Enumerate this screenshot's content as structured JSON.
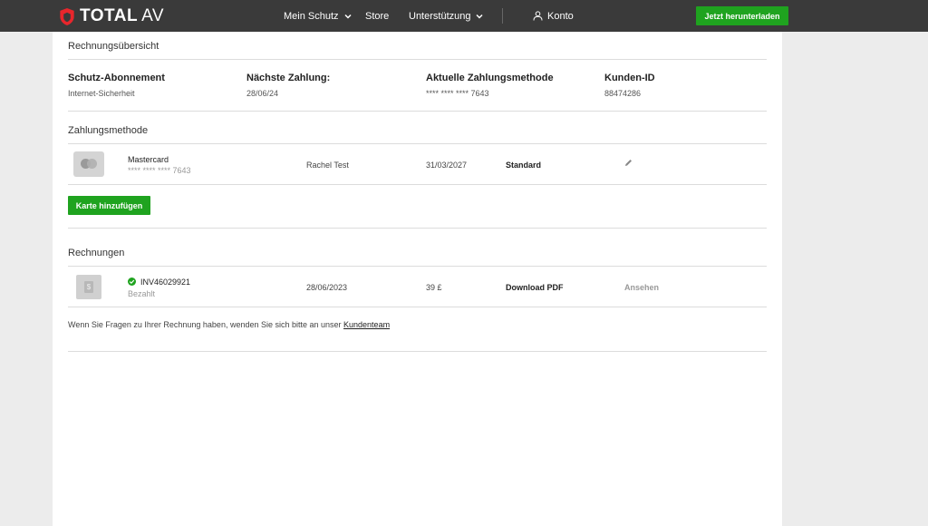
{
  "header": {
    "logo_total": "TOTAL",
    "logo_av": "AV",
    "nav": {
      "mein_schutz": "Mein Schutz",
      "store": "Store",
      "support": "Unterstützung",
      "account": "Konto"
    },
    "download_button": "Jetzt herunterladen"
  },
  "billing_overview": {
    "title": "Rechnungsübersicht",
    "subscription_label": "Schutz-Abonnement",
    "subscription_value": "Internet-Sicherheit",
    "next_payment_label": "Nächste Zahlung:",
    "next_payment_value": "28/06/24",
    "payment_method_label": "Aktuelle Zahlungsmethode",
    "payment_method_value": "**** **** **** 7643",
    "customer_id_label": "Kunden-ID",
    "customer_id_value": "88474286"
  },
  "payment_methods": {
    "title": "Zahlungsmethode",
    "card": {
      "brand": "Mastercard",
      "number": "**** **** **** 7643",
      "holder": "Rachel Test",
      "expiry": "31/03/2027",
      "badge": "Standard"
    },
    "add_card_button": "Karte hinzufügen"
  },
  "invoices": {
    "title": "Rechnungen",
    "items": [
      {
        "id": "INV46029921",
        "status": "Bezahlt",
        "date": "28/06/2023",
        "amount": "39 £",
        "download": "Download PDF",
        "view": "Ansehen"
      }
    ],
    "note_text": "Wenn Sie Fragen zu Ihrer Rechnung haben, wenden Sie sich bitte an unser ",
    "note_link": "Kundenteam"
  },
  "colors": {
    "accent": "#1fa31f",
    "brand_red": "#e8262c",
    "header_bg": "#3a3a3a"
  },
  "icons": [
    "shield-logo-icon",
    "chevron-down-icon",
    "user-icon",
    "mastercard-icon",
    "pencil-icon",
    "check-circle-icon",
    "invoice-document-icon"
  ]
}
